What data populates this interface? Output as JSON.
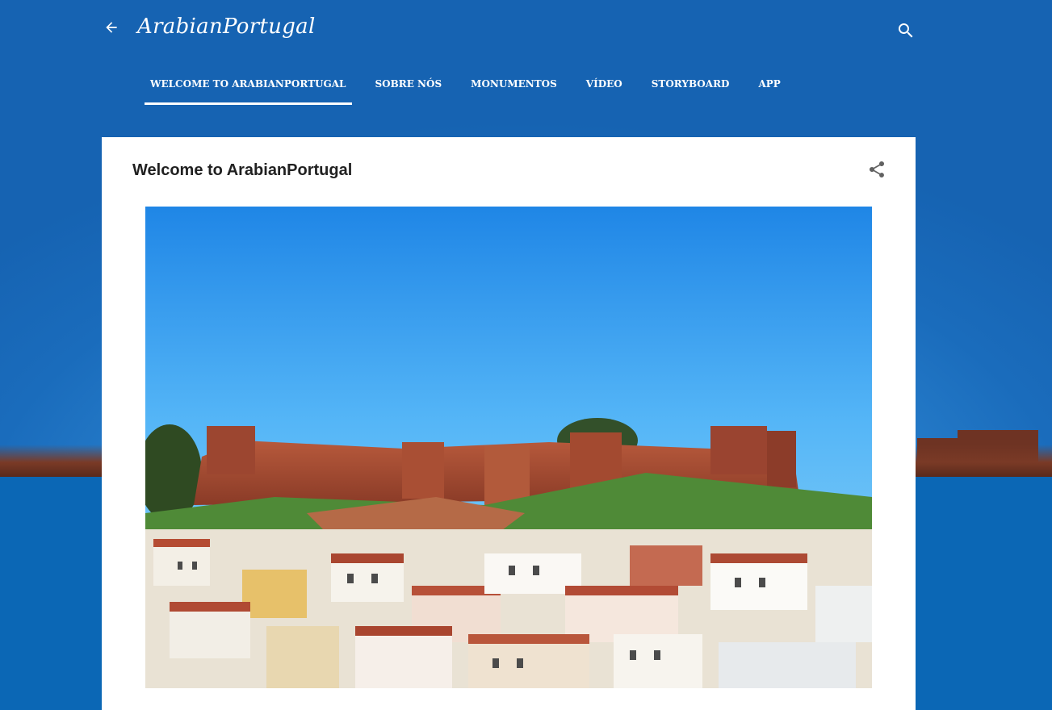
{
  "header": {
    "back_icon": "arrow-back-icon",
    "site_title": "ArabianPortugal",
    "search_icon": "search-icon"
  },
  "nav": {
    "tabs": [
      {
        "label": "WELCOME TO ARABIANPORTUGAL",
        "active": true
      },
      {
        "label": "SOBRE NÓS",
        "active": false
      },
      {
        "label": "MONUMENTOS",
        "active": false
      },
      {
        "label": "VÍDEO",
        "active": false
      },
      {
        "label": "STORYBOARD",
        "active": false
      },
      {
        "label": "APP",
        "active": false
      }
    ]
  },
  "post": {
    "title": "Welcome to ArabianPortugal",
    "share_icon": "share-icon",
    "image_subject": "castle-on-hill-with-town-photo"
  },
  "colors": {
    "page_background": "#0b67b5",
    "card_background": "#ffffff",
    "header_text": "#ffffff",
    "title_text": "#212121"
  }
}
